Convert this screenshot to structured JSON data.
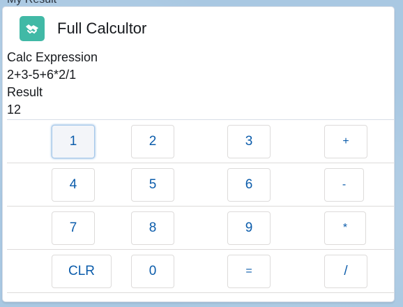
{
  "page": {
    "top_label": "My Result"
  },
  "card": {
    "title": "Full Calcultor",
    "icon": "handshake-icon",
    "accent_color": "#41b9a6"
  },
  "fields": {
    "expression_label": "Calc Expression",
    "expression_value": "2+3-5+6*2/1",
    "result_label": "Result",
    "result_value": "12"
  },
  "keypad": {
    "rows": [
      [
        "1",
        "2",
        "3",
        "+"
      ],
      [
        "4",
        "5",
        "6",
        "-"
      ],
      [
        "7",
        "8",
        "9",
        "*"
      ],
      [
        "CLR",
        "0",
        "=",
        "/"
      ]
    ],
    "focused_key": "1",
    "key_text_color": "#0b5cab"
  }
}
